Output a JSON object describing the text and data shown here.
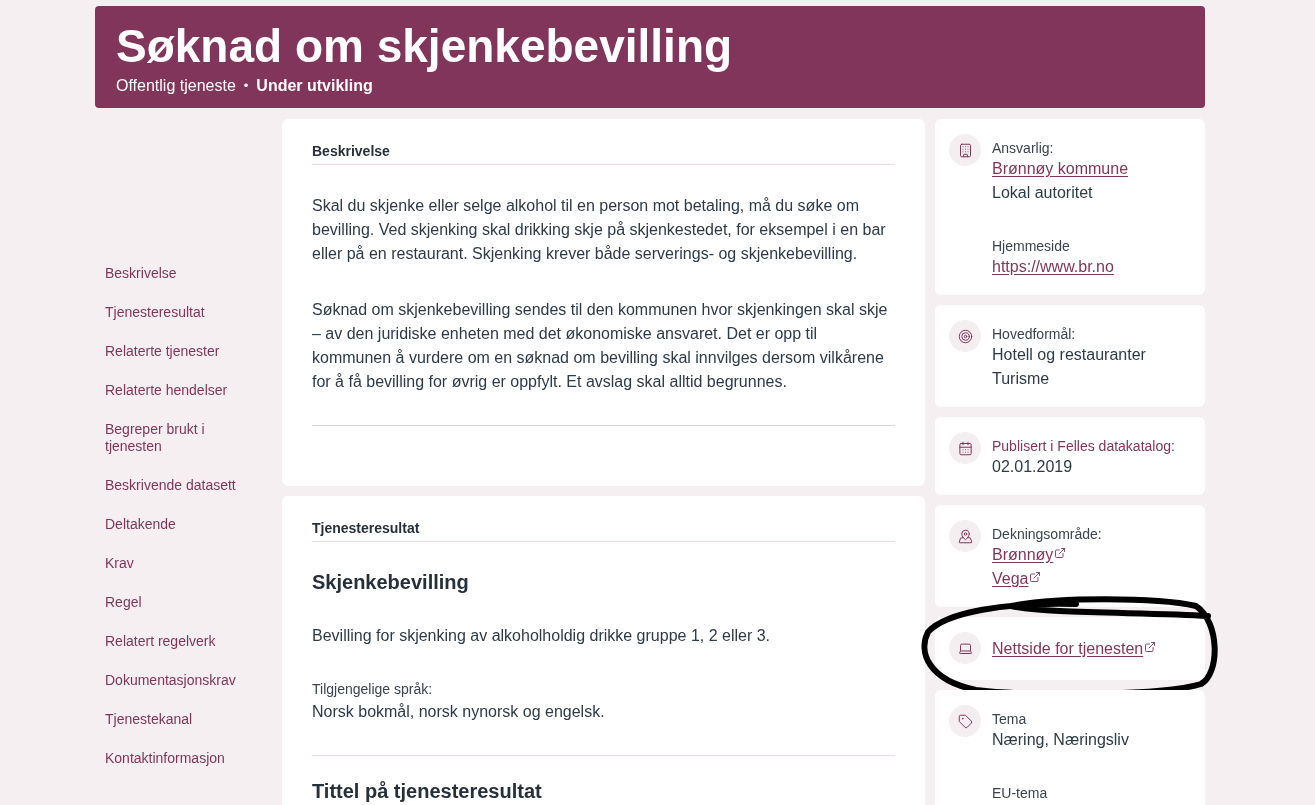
{
  "header": {
    "title": "Søknad om skjenkebevilling",
    "subtitle": [
      {
        "kind": "type",
        "text": "Offentlig tjeneste"
      },
      {
        "kind": "separator",
        "text": "•"
      },
      {
        "kind": "status",
        "text": "Under utvikling"
      }
    ]
  },
  "nav": {
    "items": [
      "Beskrivelse",
      "Tjenesteresultat",
      "Relaterte tjenester",
      "Relaterte hendelser",
      "Begreper brukt i tjenesten",
      "Beskrivende datasett",
      "Deltakende",
      "Krav",
      "Regel",
      "Relatert regelverk",
      "Dokumentasjonskrav",
      "Tjenestekanal",
      "Kontaktinformasjon"
    ]
  },
  "sections": [
    {
      "kind": "text",
      "heading": "Beskrivelse",
      "paragraphs": [
        "Skal du skjenke eller selge alkohol til en person mot betaling, må du søke om bevilling. Ved skjenking skal drikking skje på skjenkestedet, for eksempel i en bar eller på en restaurant. Skjenking krever både serverings- og skjenkebevilling.",
        "Søknad om skjenkebevilling sendes til den kommunen hvor skjenkingen skal skje – av den juridiske enheten med det økonomiske ansvaret. Det er opp til kommunen å vurdere om en søknad om bevilling skal innvilges dersom vilkårene for å få bevilling for øvrig er oppfylt. Et avslag skal alltid begrunnes."
      ]
    },
    {
      "kind": "results",
      "heading": "Tjenesteresultat",
      "results": [
        {
          "title": "Skjenkebevilling",
          "description": "Bevilling for skjenking av alkoholholdig drikke gruppe 1, 2 eller 3.",
          "languages_label": "Tilgjengelige språk:",
          "languages": "Norsk bokmål, norsk nynorsk og engelsk."
        },
        {
          "title": "Tittel på tjenesteresultat"
        }
      ]
    }
  ],
  "info_cards": [
    {
      "kind": "responsible",
      "circled": false,
      "fields": [
        {
          "label": "Ansvarlig:",
          "accented": false,
          "values": [
            {
              "kind": "link",
              "text": "Brønnøy kommune"
            },
            {
              "kind": "text",
              "text": "Lokal autoritet"
            }
          ]
        },
        {
          "label": "Hjemmeside",
          "accented": false,
          "values": [
            {
              "kind": "link",
              "text": "https://www.br.no"
            }
          ]
        }
      ]
    },
    {
      "kind": "purpose",
      "circled": false,
      "fields": [
        {
          "label": "Hovedformål:",
          "accented": false,
          "values": [
            {
              "kind": "text",
              "text": "Hotell og restauranter"
            },
            {
              "kind": "text",
              "text": "Turisme"
            }
          ]
        }
      ]
    },
    {
      "kind": "published",
      "circled": false,
      "fields": [
        {
          "label": "Publisert i Felles datakatalog:",
          "accented": true,
          "values": [
            {
              "kind": "text",
              "text": "02.01.2019"
            }
          ]
        }
      ]
    },
    {
      "kind": "coverage",
      "circled": false,
      "fields": [
        {
          "label": "Dekningsområde:",
          "accented": false,
          "values": [
            {
              "kind": "external_link",
              "text": "Brønnøy"
            },
            {
              "kind": "external_link",
              "text": "Vega"
            }
          ]
        }
      ]
    },
    {
      "kind": "website",
      "circled": true,
      "fields": [
        {
          "values": [
            {
              "kind": "external_link",
              "text": "Nettside for tjenesten"
            }
          ]
        }
      ]
    },
    {
      "kind": "theme",
      "circled": false,
      "fields": [
        {
          "label": "Tema",
          "accented": false,
          "values": [
            {
              "kind": "text",
              "text": "Næring, Næringsliv"
            }
          ]
        },
        {
          "label": "EU-tema",
          "accented": false
        }
      ]
    }
  ]
}
